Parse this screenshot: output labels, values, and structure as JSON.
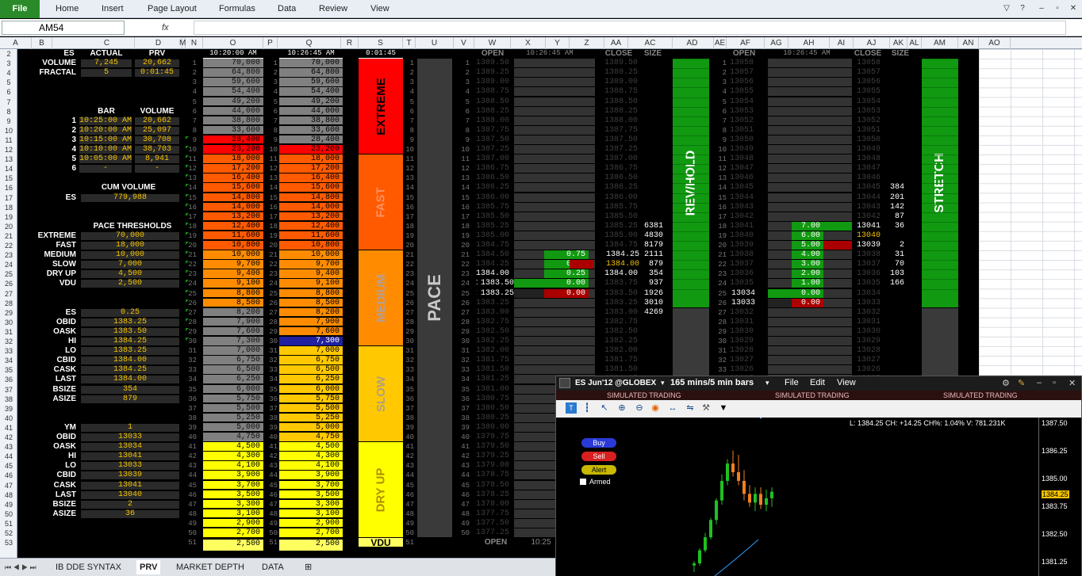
{
  "ribbon": {
    "file": "File",
    "tabs": [
      "Home",
      "Insert",
      "Page Layout",
      "Formulas",
      "Data",
      "Review",
      "View"
    ]
  },
  "formula": {
    "namebox": "AM54",
    "fx": "fx",
    "content": ""
  },
  "columns": [
    "A",
    "B",
    "C",
    "D",
    "M",
    "N",
    "O",
    "P",
    "Q",
    "R",
    "S",
    "T",
    "U",
    "V",
    "W",
    "X",
    "Y",
    "Z",
    "AA",
    "AC",
    "AD",
    "AE",
    "AF",
    "AG",
    "AH",
    "AI",
    "AJ",
    "AK",
    "AL",
    "AM",
    "AN",
    "AO"
  ],
  "rows_start": 2,
  "left": {
    "hdr_es": "ES",
    "hdr_actual": "ACTUAL",
    "hdr_prv": "PRV",
    "volume_lbl": "VOLUME",
    "volume_actual": "7,245",
    "volume_prv": "20,662",
    "fractal_lbl": "FRACTAL",
    "fractal_actual": "5",
    "fractal_prv": "0:01:45",
    "bar_hdr": "BAR",
    "volume_hdr": "VOLUME",
    "bars": [
      {
        "n": "1",
        "t": "10:25:00 AM",
        "v": "20,662"
      },
      {
        "n": "2",
        "t": "10:20:00 AM",
        "v": "25,097"
      },
      {
        "n": "3",
        "t": "10:15:00 AM",
        "v": "30,708"
      },
      {
        "n": "4",
        "t": "10:10:00 AM",
        "v": "38,703"
      },
      {
        "n": "5",
        "t": "10:05:00 AM",
        "v": "8,941"
      },
      {
        "n": "6",
        "t": "-",
        "v": "-"
      }
    ],
    "cum_hdr": "CUM VOLUME",
    "cum_lbl": "ES",
    "cum_val": "779,988",
    "pace_hdr": "PACE THRESHOLDS",
    "pace": [
      {
        "l": "EXTREME",
        "v": "70,000"
      },
      {
        "l": "FAST",
        "v": "18,000"
      },
      {
        "l": "MEDIUM",
        "v": "10,000"
      },
      {
        "l": "SLOW",
        "v": "7,000"
      },
      {
        "l": "DRY UP",
        "v": "4,500"
      },
      {
        "l": "VDU",
        "v": "2,500"
      }
    ],
    "es_block": [
      {
        "l": "ES",
        "v": "0.25"
      },
      {
        "l": "OBID",
        "v": "1383.25"
      },
      {
        "l": "OASK",
        "v": "1383.50"
      },
      {
        "l": "HI",
        "v": "1384.25"
      },
      {
        "l": "LO",
        "v": "1383.25"
      },
      {
        "l": "CBID",
        "v": "1384.00"
      },
      {
        "l": "CASK",
        "v": "1384.25"
      },
      {
        "l": "LAST",
        "v": "1384.00"
      },
      {
        "l": "BSIZE",
        "v": "354"
      },
      {
        "l": "ASIZE",
        "v": "879"
      }
    ],
    "ym_block": [
      {
        "l": "YM",
        "v": "1"
      },
      {
        "l": "OBID",
        "v": "13033"
      },
      {
        "l": "OASK",
        "v": "13034"
      },
      {
        "l": "HI",
        "v": "13041"
      },
      {
        "l": "LO",
        "v": "13033"
      },
      {
        "l": "CBID",
        "v": "13039"
      },
      {
        "l": "CASK",
        "v": "13041"
      },
      {
        "l": "LAST",
        "v": "13040"
      },
      {
        "l": "BSIZE",
        "v": "2"
      },
      {
        "l": "ASIZE",
        "v": "36"
      }
    ]
  },
  "ladder": {
    "time_n": "10:20:00 AM",
    "time_p": "10:26:45 AM",
    "time_r": "0:01:45",
    "values": [
      "70,000",
      "64,800",
      "59,600",
      "54,400",
      "49,200",
      "44,000",
      "38,800",
      "33,600",
      "28,400",
      "23,200",
      "18,000",
      "17,200",
      "16,400",
      "15,600",
      "14,800",
      "14,000",
      "13,200",
      "12,400",
      "11,600",
      "10,800",
      "10,000",
      "9,700",
      "9,400",
      "9,100",
      "8,800",
      "8,500",
      "8,200",
      "7,900",
      "7,600",
      "7,300",
      "7,000",
      "6,750",
      "6,500",
      "6,250",
      "6,000",
      "5,750",
      "5,500",
      "5,250",
      "5,000",
      "4,750",
      "4,500",
      "4,300",
      "4,100",
      "3,900",
      "3,700",
      "3,500",
      "3,300",
      "3,100",
      "2,900",
      "2,700"
    ],
    "last_value": "2,500",
    "zones": [
      "EXTREME",
      "FAST",
      "MEDIUM",
      "SLOW",
      "DRY UP",
      "VDU"
    ],
    "pace": "PACE",
    "colors": {
      "extreme": "#ff0000",
      "fast": "#ff5a00",
      "medium": "#ff8c00",
      "slow": "#ffc800",
      "dryup": "#ffff00",
      "vdu": "#ffff60",
      "grey": "#808080",
      "hilite": "#2020a0"
    }
  },
  "es_depth": {
    "open_hdr": "OPEN",
    "time": "10:26:45 AM",
    "close_hdr": "CLOSE",
    "size_hdr": "SIZE",
    "open": [
      "1389.50",
      "1389.25",
      "1389.00",
      "1388.75",
      "1388.50",
      "1388.25",
      "1388.00",
      "1387.75",
      "1387.50",
      "1387.25",
      "1387.00",
      "1386.75",
      "1386.50",
      "1386.25",
      "1386.00",
      "1385.75",
      "1385.50",
      "1385.25",
      "1385.00",
      "1384.75",
      "1384.50",
      "1384.25",
      "1384.00",
      "1383.75",
      "1383.50",
      "1383.25",
      "1383.00",
      "1382.75",
      "1382.50",
      "1382.25",
      "1382.00",
      "1381.75",
      "1381.50",
      "1381.25",
      "1381.00",
      "1380.75",
      "1380.50",
      "1380.25",
      "1380.00",
      "1379.75",
      "1379.50",
      "1379.25",
      "1379.00",
      "1378.75",
      "1378.50",
      "1378.25",
      "1378.00",
      "1377.75",
      "1377.50",
      "1377.25"
    ],
    "greenbars": [
      {
        "row": 22,
        "v": "0.75"
      },
      {
        "row": 23,
        "v": "0.50"
      },
      {
        "row": 24,
        "v": "0.25"
      },
      {
        "row": 25,
        "v": "0.00"
      }
    ],
    "redbars": [
      {
        "row": 23
      },
      {
        "row": 26,
        "v": "0.00"
      }
    ],
    "sizes": [
      {
        "row": 18,
        "s": "6381"
      },
      {
        "row": 19,
        "s": "4830"
      },
      {
        "row": 20,
        "s": "8179"
      },
      {
        "row": 21,
        "s": "2111"
      },
      {
        "row": 22,
        "s": "879"
      },
      {
        "row": 23,
        "s": "354"
      },
      {
        "row": 24,
        "s": "937"
      },
      {
        "row": 25,
        "s": "1926"
      },
      {
        "row": 26,
        "s": "3010"
      },
      {
        "row": 27,
        "s": "4269"
      }
    ],
    "footer_open": "OPEN",
    "footer_time": "10:25"
  },
  "revhold": "REV/HOLD",
  "ym_depth": {
    "open_hdr": "OPEN",
    "time": "10:26:45 AM",
    "close_hdr": "CLOSE",
    "size_hdr": "SIZE",
    "green": [
      {
        "row": 18,
        "v": "7.00"
      },
      {
        "row": 19,
        "v": "6.00"
      },
      {
        "row": 20,
        "v": "5.00"
      },
      {
        "row": 21,
        "v": "4.00"
      },
      {
        "row": 22,
        "v": "3.00"
      },
      {
        "row": 23,
        "v": "2.00"
      },
      {
        "row": 24,
        "v": "1.00"
      },
      {
        "row": 25,
        "v": "0.00"
      }
    ],
    "red": [
      {
        "row": 26,
        "v": "0.00"
      }
    ],
    "sizes": [
      {
        "row": 14,
        "s": "384"
      },
      {
        "row": 15,
        "s": "201"
      },
      {
        "row": 16,
        "s": "142"
      },
      {
        "row": 17,
        "s": "87"
      },
      {
        "row": 18,
        "s": "36"
      },
      {
        "row": 20,
        "s": "2"
      },
      {
        "row": 21,
        "s": "31"
      },
      {
        "row": 22,
        "s": "70"
      },
      {
        "row": 23,
        "s": "103"
      },
      {
        "row": 24,
        "s": "166"
      }
    ],
    "hl": [
      {
        "row": 18,
        "v": "13041"
      },
      {
        "row": 19,
        "v": "13040"
      },
      {
        "row": 20,
        "v": "13039"
      }
    ],
    "hl_open": [
      {
        "row": 25,
        "v": "13034"
      },
      {
        "row": 26,
        "v": "13033"
      }
    ]
  },
  "stretch": "STRETCH",
  "sheets": [
    "IB DDE SYNTAX",
    "PRV",
    "MARKET DEPTH",
    "DATA"
  ],
  "chartwin": {
    "symbol": "ES Jun'12 @GLOBEX",
    "interval": "165 mins/5 min bars",
    "menus": [
      "File",
      "Edit",
      "View"
    ],
    "sim": "SIMULATED TRADING",
    "info": "L: 1384.25 CH: +14.25 CH%: 1.04% V: 781.231K",
    "buttons": [
      "Buy",
      "Sell",
      "Alert"
    ],
    "armed": "Armed",
    "prices": [
      "1387.50",
      "1386.25",
      "1385.00",
      "1384.25",
      "1383.75",
      "1382.50",
      "1381.25"
    ]
  },
  "chart_data": {
    "type": "candlestick",
    "ylim": [
      1381.0,
      1387.5
    ],
    "candles": [
      [
        1380.9,
        1381.1,
        1380.6,
        1381.0,
        "up"
      ],
      [
        1381.0,
        1381.7,
        1380.9,
        1381.6,
        "up"
      ],
      [
        1381.6,
        1382.4,
        1381.5,
        1382.2,
        "up"
      ],
      [
        1382.2,
        1383.1,
        1382.1,
        1383.0,
        "up"
      ],
      [
        1383.0,
        1384.0,
        1382.8,
        1383.9,
        "up"
      ],
      [
        1383.9,
        1385.1,
        1383.7,
        1384.8,
        "up"
      ],
      [
        1384.8,
        1385.8,
        1384.6,
        1385.6,
        "up"
      ],
      [
        1385.6,
        1386.2,
        1385.0,
        1385.2,
        "dn"
      ],
      [
        1385.2,
        1386.0,
        1384.6,
        1384.8,
        "dn"
      ],
      [
        1384.8,
        1385.3,
        1383.9,
        1384.2,
        "dn"
      ],
      [
        1384.2,
        1384.6,
        1383.6,
        1383.8,
        "dn"
      ],
      [
        1383.8,
        1384.5,
        1383.4,
        1384.2,
        "up"
      ],
      [
        1384.2,
        1384.5,
        1383.5,
        1383.7,
        "dn"
      ],
      [
        1383.7,
        1384.4,
        1383.4,
        1384.0,
        "up"
      ],
      [
        1384.0,
        1384.5,
        1383.6,
        1384.3,
        "up"
      ]
    ]
  }
}
